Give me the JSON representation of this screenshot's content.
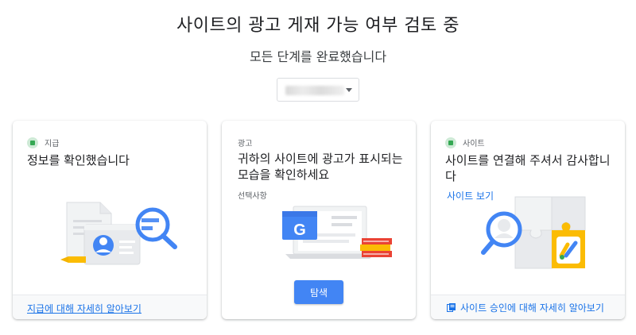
{
  "header": {
    "title": "사이트의 광고 게재 가능 여부 검토 중",
    "subtitle": "모든 단계를 완료했습니다"
  },
  "site_select": {
    "selected_value": "",
    "icon": "chevron-down-icon"
  },
  "cards": [
    {
      "status_label": "지급",
      "status_icon": "check-icon",
      "title": "정보를 확인했습니다",
      "illustration": "payment-document-search-illustration",
      "footer_link": "지급에 대해 자세히 알아보기"
    },
    {
      "status_label": "광고",
      "title": "귀하의 사이트에 광고가 표시되는 모습을 확인하세요",
      "optional_note": "선택사항",
      "illustration": "google-ads-laptop-illustration",
      "button_label": "탐색"
    },
    {
      "status_label": "사이트",
      "status_icon": "check-icon",
      "title": "사이트를 연결해 주셔서 감사합니다",
      "link": "사이트 보기",
      "illustration": "site-puzzle-search-illustration",
      "footer_link": "사이트 승인에 대해 자세히 알아보기",
      "footer_icon": "book-icon"
    }
  ],
  "colors": {
    "accent_blue": "#1a73e8",
    "button_blue": "#4285f4",
    "success_green": "#34a853",
    "adsense_yellow": "#fbbc04"
  }
}
